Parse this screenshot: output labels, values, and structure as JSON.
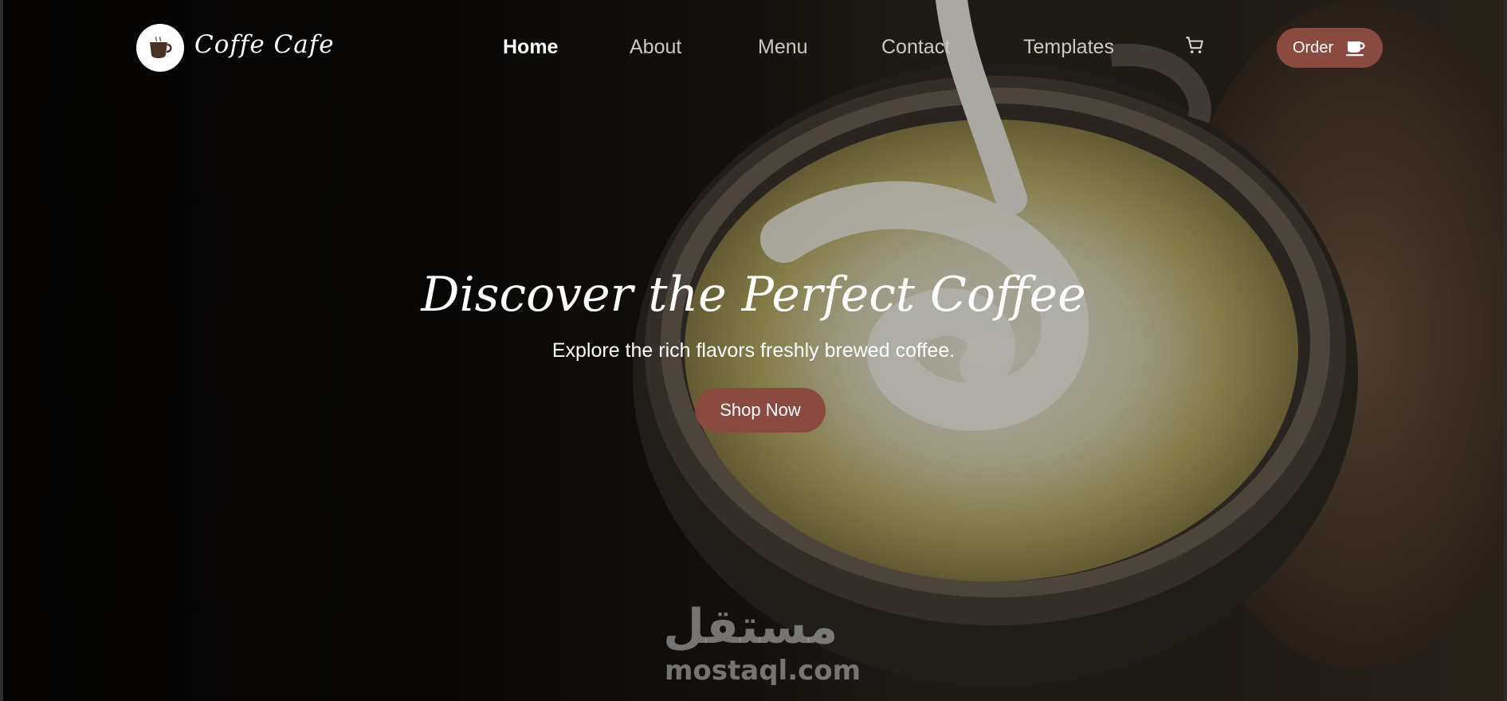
{
  "brand": {
    "name": "Coffe Cafe",
    "logo_icon": "coffee-cup-icon"
  },
  "nav": {
    "links": [
      {
        "label": "Home",
        "active": true
      },
      {
        "label": "About",
        "active": false
      },
      {
        "label": "Menu",
        "active": false
      },
      {
        "label": "Contact",
        "active": false
      },
      {
        "label": "Templates",
        "active": false
      }
    ],
    "cart_icon": "cart-icon",
    "order_label": "Order",
    "order_icon": "coffee-cup-icon"
  },
  "hero": {
    "title": "Discover the Perfect Coffee",
    "subtitle": "Explore the rich flavors freshly brewed coffee.",
    "cta_label": "Shop Now"
  },
  "watermark": {
    "arabic": "مستقل",
    "latin": "mostaql.com"
  },
  "colors": {
    "accent": "#8b4a3f",
    "text": "#ffffff",
    "nav_text": "#cfc8c0"
  }
}
